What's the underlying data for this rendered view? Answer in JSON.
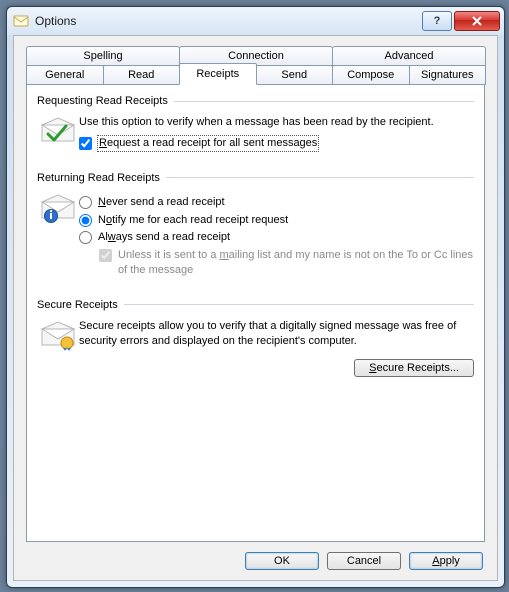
{
  "window": {
    "title": "Options",
    "help_tooltip": "?",
    "close_tooltip": "Close"
  },
  "tabs": {
    "row1": [
      "Spelling",
      "Connection",
      "Advanced"
    ],
    "row2": [
      "General",
      "Read",
      "Receipts",
      "Send",
      "Compose",
      "Signatures"
    ],
    "active": "Receipts"
  },
  "requesting": {
    "title": "Requesting Read Receipts",
    "desc": "Use this option to verify when a message has been read by the recipient.",
    "checkbox_label": "Request a read receipt for all sent messages",
    "checkbox_checked": true
  },
  "returning": {
    "title": "Returning Read Receipts",
    "never": "Never send a read receipt",
    "notify": "Notify me for each read receipt request",
    "always": "Always send a read receipt",
    "selected": "notify",
    "unless_label": "Unless it is sent to a mailing list and my name is not on the To or Cc lines of the message",
    "unless_checked": true,
    "unless_enabled": false
  },
  "secure": {
    "title": "Secure Receipts",
    "desc": "Secure receipts allow you to verify that a digitally signed message was free of security errors and displayed on the recipient's computer.",
    "button": "Secure Receipts..."
  },
  "buttons": {
    "ok": "OK",
    "cancel": "Cancel",
    "apply": "Apply"
  }
}
